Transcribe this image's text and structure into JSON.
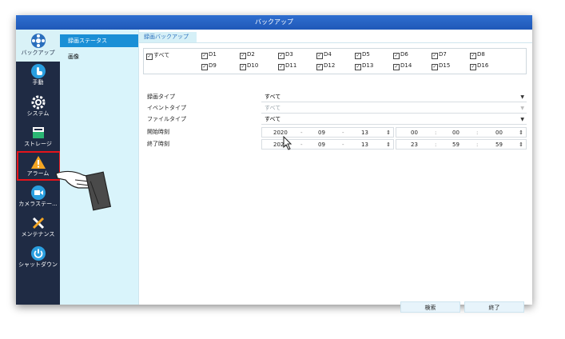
{
  "window": {
    "title": "バックアップ"
  },
  "sidebar": {
    "items": [
      {
        "label": "バックアップ",
        "icon": "film-reel-icon",
        "active": true
      },
      {
        "label": "手動",
        "icon": "hand-click-icon"
      },
      {
        "label": "システム",
        "icon": "gear-icon"
      },
      {
        "label": "ストレージ",
        "icon": "storage-icon"
      },
      {
        "label": "アラーム",
        "icon": "warning-icon"
      },
      {
        "label": "カメラステー...",
        "icon": "camera-icon"
      },
      {
        "label": "メンテナンス",
        "icon": "wrench-icon"
      },
      {
        "label": "シャットダウン",
        "icon": "power-icon"
      }
    ]
  },
  "subnav": {
    "items": [
      {
        "label": "録画ステータス",
        "active": true
      },
      {
        "label": "画像"
      }
    ]
  },
  "main": {
    "tab": "録画バックアップ",
    "channels": {
      "all_label": "すべて",
      "row1": [
        "D1",
        "D2",
        "D3",
        "D4",
        "D5",
        "D6",
        "D7",
        "D8"
      ],
      "row2": [
        "D9",
        "D10",
        "D11",
        "D12",
        "D13",
        "D14",
        "D15",
        "D16"
      ]
    },
    "form": {
      "record_type": {
        "label": "録画タイプ",
        "value": "すべて"
      },
      "event_type": {
        "label": "イベントタイプ",
        "value": "すべて"
      },
      "file_type": {
        "label": "ファイルタイプ",
        "value": "すべて"
      },
      "start_time": {
        "label": "開始時刻",
        "year": "2020",
        "month": "09",
        "day": "13",
        "hour": "00",
        "minute": "00",
        "second": "00"
      },
      "end_time": {
        "label": "終了時刻",
        "year": "2020",
        "month": "09",
        "day": "13",
        "hour": "23",
        "minute": "59",
        "second": "59"
      }
    },
    "buttons": {
      "search": "検索",
      "exit": "終了"
    }
  },
  "colors": {
    "titlebar": "#1f58b8",
    "sidebar": "#1f2b44",
    "accent": "#1a8fd6",
    "highlight": "#e4141b"
  }
}
